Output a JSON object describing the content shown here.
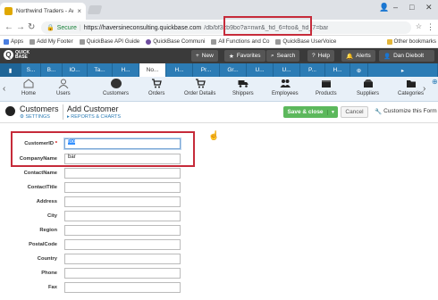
{
  "browser": {
    "tab_title": "Northwind Traders - Add",
    "secure_label": "Secure",
    "url_host": "https://haversineconsulting.quickbase.com",
    "url_path": "/db/bf3zb9bo?a=nwr&_fid_6=foo&_fid_7=bar",
    "bookmarks": [
      "Apps",
      "Add My Footer",
      "QuickBase API Guide",
      "QuickBase Communi",
      "All Functions and Co",
      "QuickBase UserVoice"
    ],
    "other_bookmarks": "Other bookmarks"
  },
  "qb_nav": {
    "logo": "QUICK BASE",
    "new": "New",
    "favorites": "Favorites",
    "search": "Search",
    "help": "Help",
    "alerts": "Alerts",
    "user": "Dan Diebolt"
  },
  "app_tabs": [
    "S...",
    "B...",
    "IO...",
    "Ta...",
    "H...",
    "No...",
    "H...",
    "Pr...",
    "Gr...",
    "U...",
    "U...",
    "P...",
    "H..."
  ],
  "table_bar": {
    "items": [
      {
        "label": "Home",
        "icon": "house-icon"
      },
      {
        "label": "Users",
        "icon": "user-icon"
      },
      {
        "label": "Customers",
        "icon": "customer-icon"
      },
      {
        "label": "Orders",
        "icon": "cart-icon"
      },
      {
        "label": "Order Details",
        "icon": "cart-detail-icon"
      },
      {
        "label": "Shippers",
        "icon": "truck-icon"
      },
      {
        "label": "Employees",
        "icon": "people-icon"
      },
      {
        "label": "Products",
        "icon": "box-icon"
      },
      {
        "label": "Suppliers",
        "icon": "supplier-icon"
      },
      {
        "label": "Categories",
        "icon": "category-icon"
      }
    ]
  },
  "page": {
    "table_name": "Customers",
    "settings": "SETTINGS",
    "title": "Add Customer",
    "reports": "REPORTS & CHARTS",
    "save": "Save & close",
    "cancel": "Cancel",
    "customize": "Customize this Form"
  },
  "form": {
    "fields": [
      {
        "label": "CustomerID",
        "required": "*",
        "value": "foo"
      },
      {
        "label": "CompanyName",
        "required": "",
        "value": "bar"
      },
      {
        "label": "ContactName",
        "required": "",
        "value": ""
      },
      {
        "label": "ContactTitle",
        "required": "",
        "value": ""
      },
      {
        "label": "Address",
        "required": "",
        "value": ""
      },
      {
        "label": "City",
        "required": "",
        "value": ""
      },
      {
        "label": "Region",
        "required": "",
        "value": ""
      },
      {
        "label": "PostalCode",
        "required": "",
        "value": ""
      },
      {
        "label": "Country",
        "required": "",
        "value": ""
      },
      {
        "label": "Phone",
        "required": "",
        "value": ""
      },
      {
        "label": "Fax",
        "required": "",
        "value": ""
      }
    ]
  },
  "colors": {
    "brand_blue": "#2c7cb5",
    "save_green": "#5cb85c",
    "annotation_red": "#c62b3a"
  }
}
